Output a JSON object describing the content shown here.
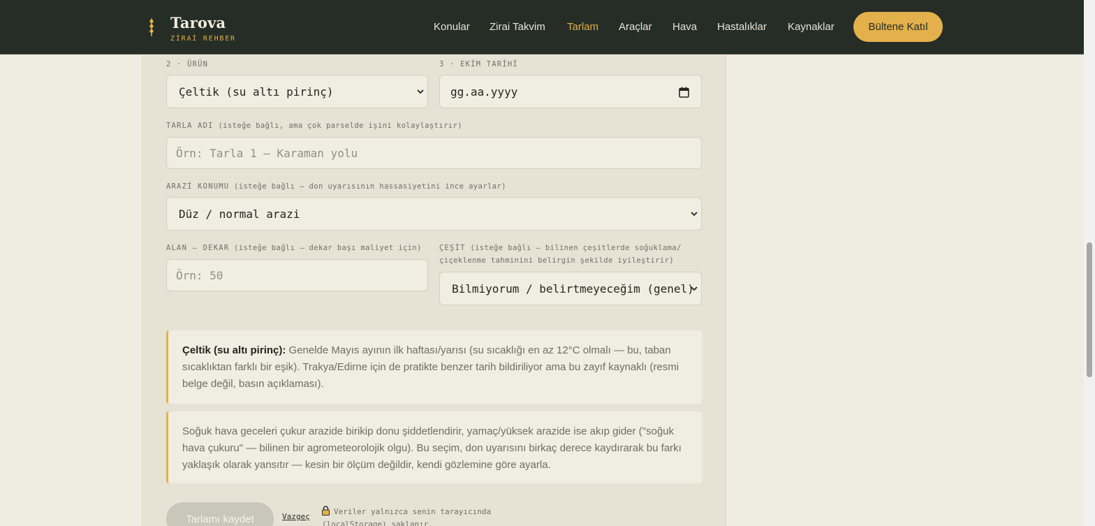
{
  "header": {
    "brand_title": "Tarova",
    "brand_subtitle": "ZİRAİ REHBER",
    "nav": [
      "Konular",
      "Zirai Takvim",
      "Tarlam",
      "Araçlar",
      "Hava",
      "Hastalıklar",
      "Kaynaklar"
    ],
    "active_nav": "Tarlam",
    "cta_label": "Bültene Katıl"
  },
  "form": {
    "product_label": "2 · ÜRÜN",
    "product_value": "Çeltik (su altı pirinç)",
    "date_label": "3 · EKİM TARİHİ",
    "date_placeholder": "gg.aa.yyyy",
    "field_name_label_caps": "TARLA ADI",
    "field_name_label_note": "(isteğe bağlı, ama çok parselde işini kolaylaştırır)",
    "field_name_placeholder": "Örn: Tarla 1 — Karaman yolu",
    "terrain_label_caps": "ARAZİ KONUMU",
    "terrain_label_note": "(isteğe bağlı — don uyarısının hassasiyetini ince ayarlar)",
    "terrain_value": "Düz / normal arazi",
    "area_label_caps": "ALAN — DEKAR",
    "area_label_note": "(isteğe bağlı — dekar başı maliyet için)",
    "area_placeholder": "Örn: 50",
    "variety_label_caps": "ÇEŞİT",
    "variety_label_line1": "(isteğe bağlı — bilinen çeşitlerde soğuklama/",
    "variety_label_line2": "çiçeklenme tahminini belirgin şekilde iyileştirir)",
    "variety_value": "Bilmiyorum / belirtmeyeceğim (genel)"
  },
  "notes": {
    "crop_title": "Çeltik (su altı pirinç):",
    "crop_text": "Genelde Mayıs ayının ilk haftası/yarısı (su sıcaklığı en az 12°C olmalı — bu, taban sıcaklıktan farklı bir eşik). Trakya/Edirne için de pratikte benzer tarih bildiriliyor ama bu zayıf kaynaklı (resmi belge değil, basın açıklaması).",
    "terrain_text": "Soğuk hava geceleri çukur arazide birikip donu şiddetlendirir, yamaç/yüksek arazide ise akıp gider (\"soğuk hava çukuru\" — bilinen bir agrometeorolojik olgu). Bu seçim, don uyarısını birkaç derece kaydırarak bu farkı yaklaşık olarak yansıtır — kesin bir ölçüm değildir, kendi gözlemine göre ayarla."
  },
  "actions": {
    "save_label": "Tarlamı kaydet",
    "cancel_label": "Vazgeç",
    "privacy_text": "Veriler yalnızca senin tarayıcında (localStorage) saklanır."
  },
  "colors": {
    "header_bg": "#252d26",
    "accent": "#e3b04b",
    "page_bg": "#efece2",
    "panel_bg": "#e6e2d4"
  }
}
